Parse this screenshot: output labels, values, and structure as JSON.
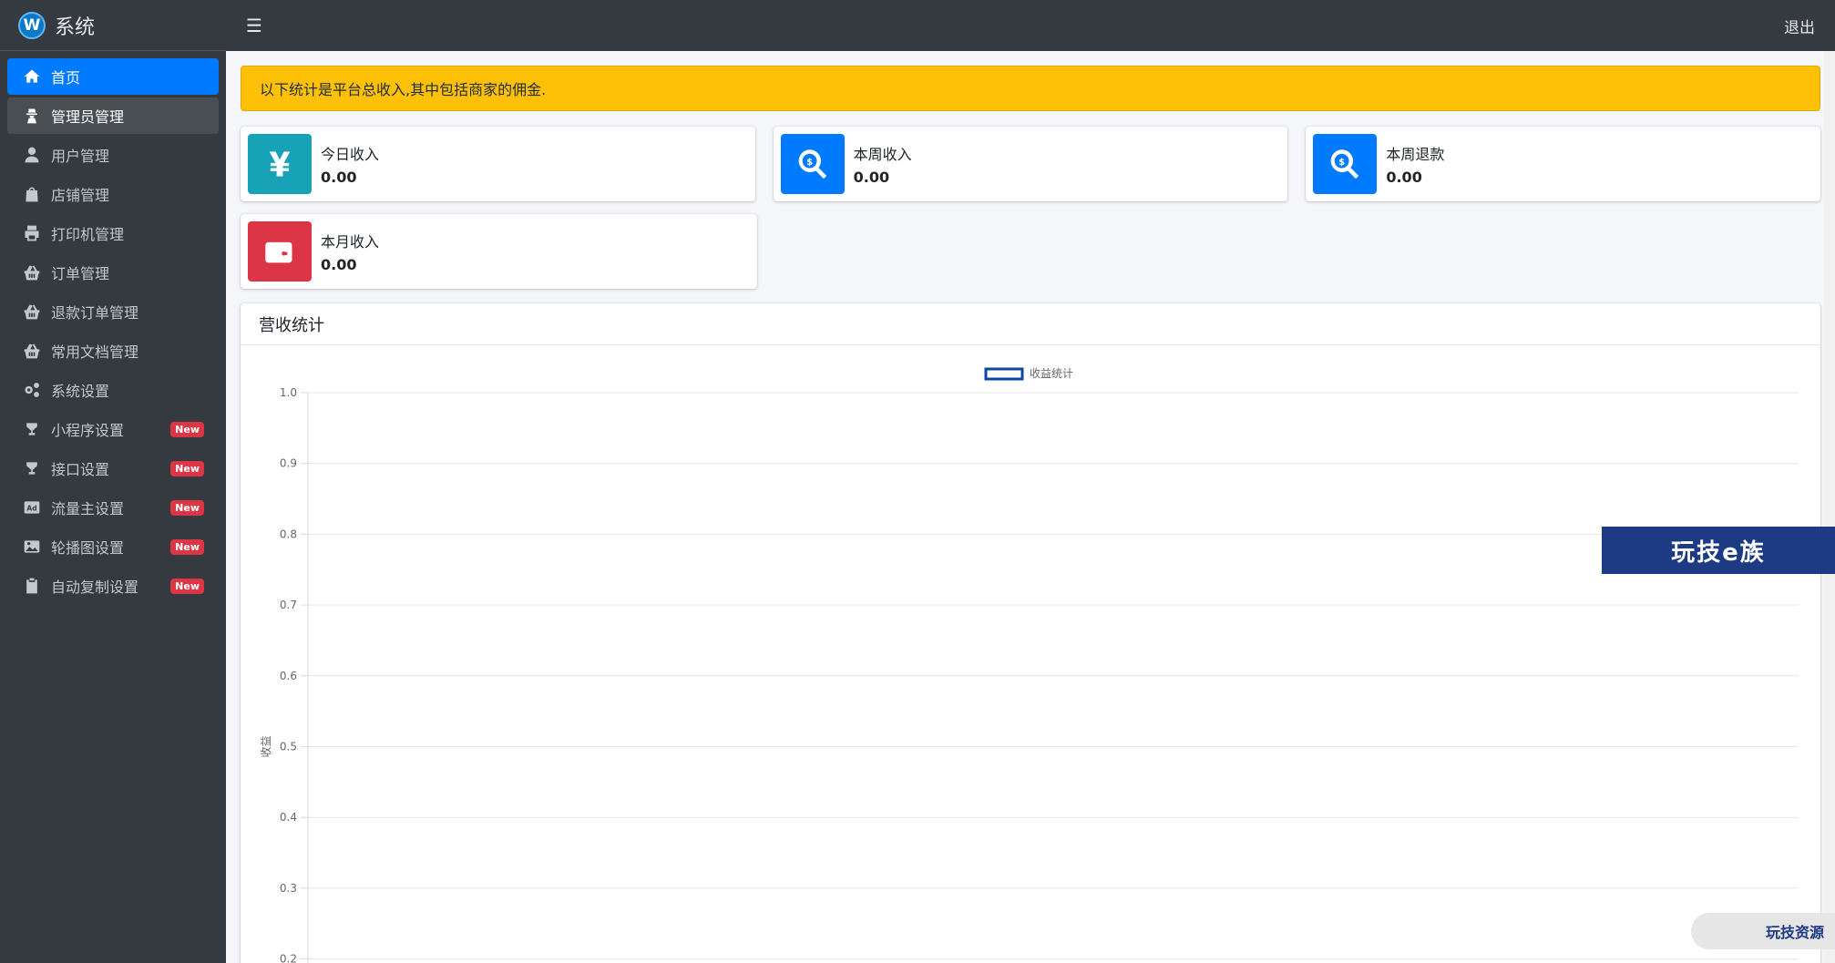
{
  "brand": {
    "title": "系统"
  },
  "topbar": {
    "menu_icon": "hamburger-icon",
    "logout_label": "退出"
  },
  "sidebar": {
    "items": [
      {
        "label": "首页",
        "icon": "home-icon",
        "state": "active"
      },
      {
        "label": "管理员管理",
        "icon": "user-secret-icon",
        "state": "hover"
      },
      {
        "label": "用户管理",
        "icon": "user-icon"
      },
      {
        "label": "店铺管理",
        "icon": "shopping-bag-icon"
      },
      {
        "label": "打印机管理",
        "icon": "printer-icon"
      },
      {
        "label": "订单管理",
        "icon": "basket-icon"
      },
      {
        "label": "退款订单管理",
        "icon": "basket-icon"
      },
      {
        "label": "常用文档管理",
        "icon": "basket-icon"
      },
      {
        "label": "系统设置",
        "icon": "cogs-icon"
      },
      {
        "label": "小程序设置",
        "icon": "trophy-icon",
        "badge": "New"
      },
      {
        "label": "接口设置",
        "icon": "trophy-icon",
        "badge": "New"
      },
      {
        "label": "流量主设置",
        "icon": "ad-icon",
        "badge": "New"
      },
      {
        "label": "轮播图设置",
        "icon": "image-icon",
        "badge": "New"
      },
      {
        "label": "自动复制设置",
        "icon": "clipboard-icon",
        "badge": "New"
      }
    ]
  },
  "alert": {
    "text": "以下统计是平台总收入,其中包括商家的佣金."
  },
  "stats": [
    {
      "label": "今日收入",
      "value": "0.00",
      "icon": "yen-icon",
      "color": "#17a2b8"
    },
    {
      "label": "本周收入",
      "value": "0.00",
      "icon": "search-dollar-icon",
      "color": "#007bff"
    },
    {
      "label": "本周退款",
      "value": "0.00",
      "icon": "search-dollar-icon",
      "color": "#007bff"
    },
    {
      "label": "本月收入",
      "value": "0.00",
      "icon": "wallet-icon",
      "color": "#dc3545"
    }
  ],
  "revenue_card": {
    "title": "营收统计"
  },
  "chart_data": {
    "type": "line",
    "title": "",
    "xlabel": "",
    "ylabel": "收益",
    "series": [
      {
        "name": "收益统计",
        "values": []
      }
    ],
    "y_ticks": [
      "1.0",
      "0.9",
      "0.8",
      "0.7",
      "0.6",
      "0.5",
      "0.4",
      "0.3",
      "0.2"
    ],
    "ylim": [
      0.2,
      1.0
    ],
    "grid": true,
    "legend": "top-center",
    "series_color": "#0d47a1"
  },
  "watermarks": {
    "banner": "玩技e族",
    "pill": "玩技资源"
  }
}
